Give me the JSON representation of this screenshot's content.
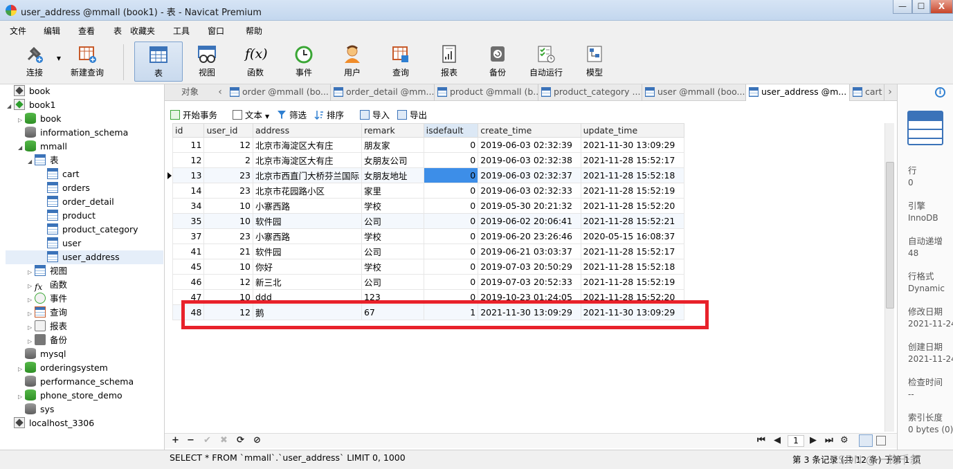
{
  "window": {
    "title": "user_address @mmall (book1) - 表 - Navicat Premium",
    "buttons": [
      "—",
      "☐",
      "X"
    ]
  },
  "menu": [
    "文件",
    "编辑",
    "查看",
    "表",
    "收藏夹",
    "工具",
    "窗口",
    "帮助"
  ],
  "toolbar": {
    "connect": "连接",
    "new_query": "新建查询",
    "table": "表",
    "view": "视图",
    "function": "函数",
    "event": "事件",
    "user": "用户",
    "query": "查询",
    "report": "报表",
    "backup": "备份",
    "autorun": "自动运行",
    "model": "模型",
    "function_glyph": "f(x)"
  },
  "tree": {
    "book": "book",
    "book1": "book1",
    "db_book": "book",
    "information_schema": "information_schema",
    "mmall": "mmall",
    "tables_group": "表",
    "tables": [
      "cart",
      "orders",
      "order_detail",
      "product",
      "product_category",
      "user",
      "user_address"
    ],
    "views": "视图",
    "functions": "函数",
    "events": "事件",
    "queries": "查询",
    "reports": "报表",
    "backups": "备份",
    "mysql": "mysql",
    "orderingsystem": "orderingsystem",
    "performance_schema": "performance_schema",
    "phone_store_demo": "phone_store_demo",
    "sys": "sys",
    "localhost": "localhost_3306"
  },
  "tabs": {
    "objects": "对象",
    "items": [
      "order @mmall (bo...",
      "order_detail @mm...",
      "product @mmall (b...",
      "product_category ...",
      "user @mmall (boo...",
      "user_address @m...",
      "cart"
    ]
  },
  "subtoolbar": {
    "begin_transaction": "开始事务",
    "text": "文本",
    "filter": "筛选",
    "sort": "排序",
    "import": "导入",
    "export": "导出"
  },
  "grid": {
    "columns": [
      "id",
      "user_id",
      "address",
      "remark",
      "isdefault",
      "create_time",
      "update_time"
    ],
    "rows": [
      [
        "11",
        "12",
        "北京市海淀区大有庄",
        "朋友家",
        "0",
        "2019-06-03 02:32:39",
        "2021-11-30 13:09:29"
      ],
      [
        "12",
        "2",
        "北京市海淀区大有庄",
        "女朋友公司",
        "0",
        "2019-06-03 02:32:38",
        "2021-11-28 15:52:17"
      ],
      [
        "13",
        "23",
        "北京市西直门大桥芬兰国际",
        "女朋友地址",
        "0",
        "2019-06-03 02:32:37",
        "2021-11-28 15:52:18"
      ],
      [
        "14",
        "23",
        "北京市花园路小区",
        "家里",
        "0",
        "2019-06-03 02:32:33",
        "2021-11-28 15:52:19"
      ],
      [
        "34",
        "10",
        "小寨西路",
        "学校",
        "0",
        "2019-05-30 20:21:32",
        "2021-11-28 15:52:20"
      ],
      [
        "35",
        "10",
        "软件园",
        "公司",
        "0",
        "2019-06-02 20:06:41",
        "2021-11-28 15:52:21"
      ],
      [
        "37",
        "23",
        "小寨西路",
        "学校",
        "0",
        "2019-06-20 23:26:46",
        "2020-05-15 16:08:37"
      ],
      [
        "41",
        "21",
        "软件园",
        "公司",
        "0",
        "2019-06-21 03:03:37",
        "2021-11-28 15:52:17"
      ],
      [
        "45",
        "10",
        "你好",
        "学校",
        "0",
        "2019-07-03 20:50:29",
        "2021-11-28 15:52:18"
      ],
      [
        "46",
        "12",
        "新三北",
        "公司",
        "0",
        "2019-07-03 20:52:33",
        "2021-11-28 15:52:19"
      ],
      [
        "47",
        "10",
        "ddd",
        "123",
        "0",
        "2019-10-23 01:24:05",
        "2021-11-28 15:52:20"
      ],
      [
        "48",
        "12",
        "鹅",
        "67",
        "1",
        "2021-11-30 13:09:29",
        "2021-11-30 13:09:29"
      ]
    ]
  },
  "bottom_nav": {
    "add": "+",
    "delete": "−",
    "apply": "✔",
    "discard": "✖",
    "refresh": "⟳",
    "stop": "⊘",
    "first": "⏮",
    "prev": "◀",
    "page": "1",
    "next": "▶",
    "last": "⏭",
    "settings": "⚙"
  },
  "status": {
    "sql": "SELECT * FROM `mmall`.`user_address` LIMIT 0, 1000",
    "record_count": "第 3 条记录 (共 12 条) 于第 1 页",
    "watermark": "CSDN @一钩千叙"
  },
  "info_panel": {
    "fields": [
      {
        "label": "行",
        "value": "0"
      },
      {
        "label": "引擎",
        "value": "InnoDB"
      },
      {
        "label": "自动递增",
        "value": "48"
      },
      {
        "label": "行格式",
        "value": "Dynamic"
      },
      {
        "label": "修改日期",
        "value": "2021-11-24"
      },
      {
        "label": "创建日期",
        "value": "2021-11-24"
      },
      {
        "label": "检查时间",
        "value": "--"
      },
      {
        "label": "索引长度",
        "value": "0 bytes (0)"
      }
    ]
  }
}
